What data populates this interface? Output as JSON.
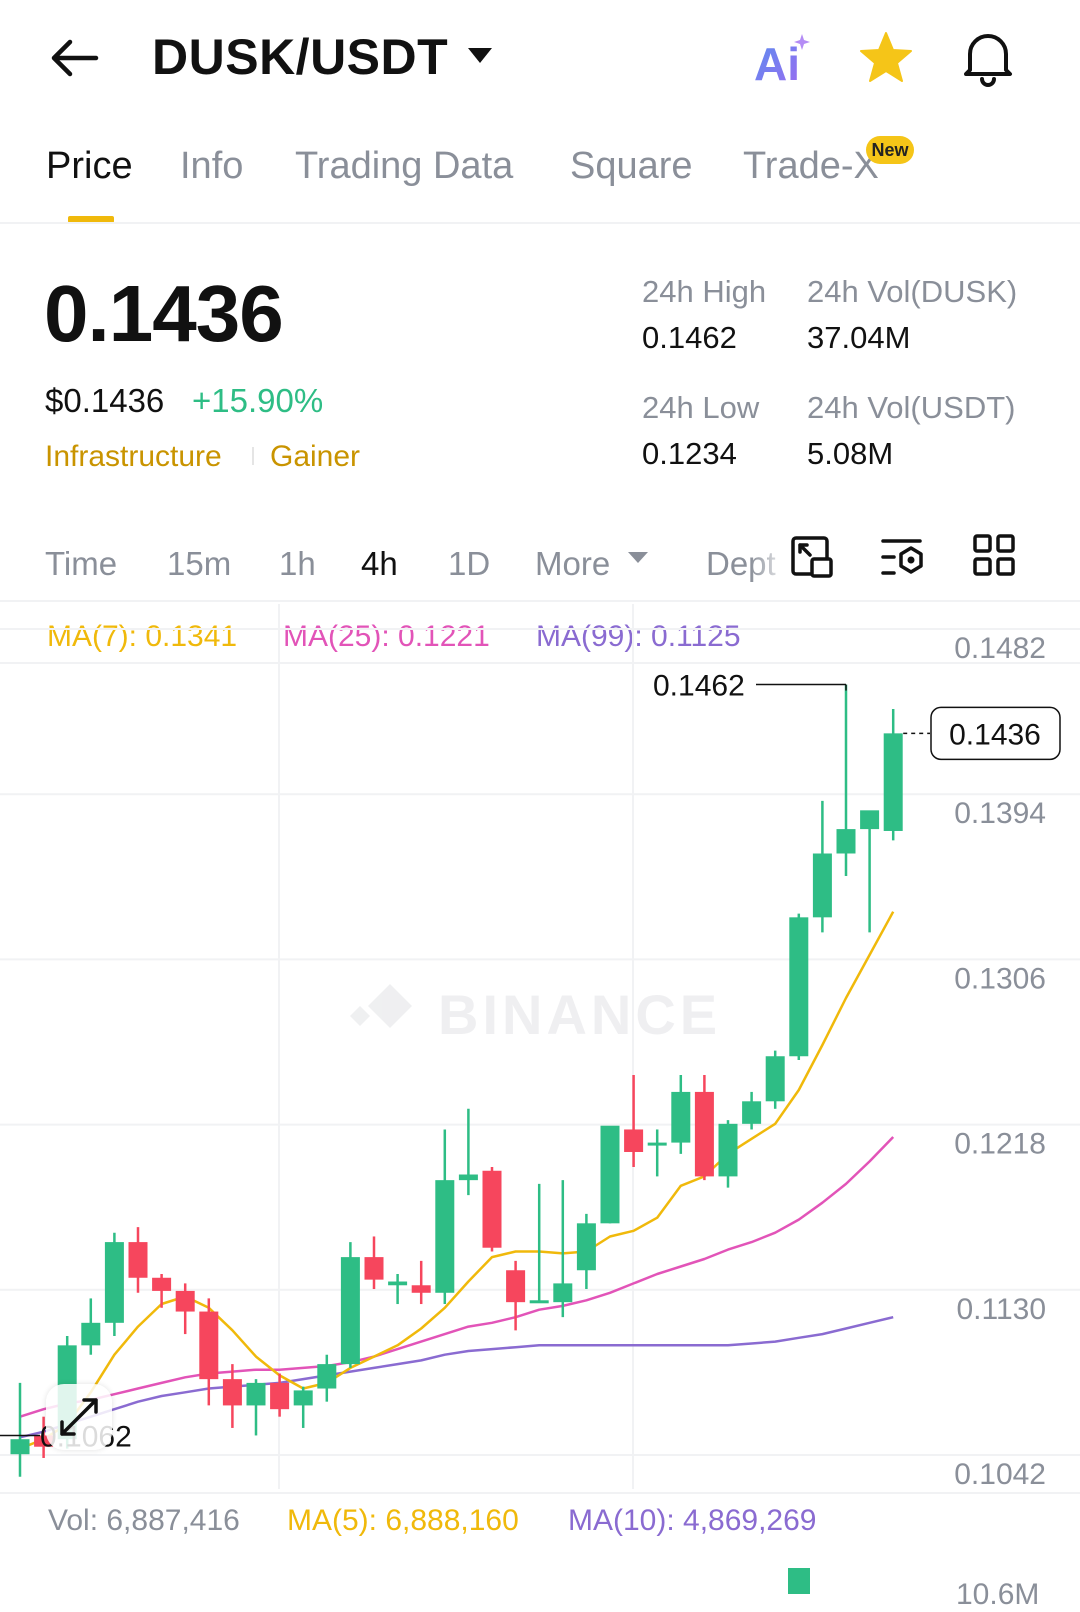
{
  "header": {
    "title": "DUSK/USDT",
    "ai_label": "Ai"
  },
  "tabs": [
    {
      "label": "Price",
      "active": true
    },
    {
      "label": "Info"
    },
    {
      "label": "Trading Data"
    },
    {
      "label": "Square"
    },
    {
      "label": "Trade-X",
      "badge": "New"
    }
  ],
  "price": {
    "last": "0.1436",
    "fiat": "$0.1436",
    "change": "+15.90%",
    "tags": [
      "Infrastructure",
      "Gainer"
    ]
  },
  "stats": {
    "high_label": "24h High",
    "high": "0.1462",
    "low_label": "24h Low",
    "low": "0.1234",
    "vol_base_label": "24h Vol(DUSK)",
    "vol_base": "37.04M",
    "vol_quote_label": "24h Vol(USDT)",
    "vol_quote": "5.08M"
  },
  "timeframes": {
    "items": [
      "Time",
      "15m",
      "1h",
      "4h",
      "1D",
      "More",
      "Dept"
    ],
    "active": "4h"
  },
  "ma": {
    "ma7": "MA(7): 0.1341",
    "ma25": "MA(25): 0.1221",
    "ma99": "MA(99): 0.1125"
  },
  "volume": {
    "vol": "Vol: 6,887,416",
    "ma5": "MA(5): 6,888,160",
    "ma10": "MA(10): 4,869,269",
    "axis_partial": "10.6M"
  },
  "colors": {
    "up": "#2ebd85",
    "down": "#f6465d",
    "ma7": "#f0b90b",
    "ma25": "#e254b8",
    "ma99": "#8a6bd1",
    "accent": "#f0b90b"
  },
  "chart_data": {
    "type": "candlestick",
    "watermark": "BINANCE",
    "y_ticks": [
      "0.1482",
      "0.1394",
      "0.1306",
      "0.1218",
      "0.1130",
      "0.1042"
    ],
    "ylim": [
      0.1042,
      0.1482
    ],
    "current_price": "0.1436",
    "high_marker": "0.1462",
    "low_marker": "0.1062",
    "candles": [
      {
        "o": 0.1052,
        "h": 0.109,
        "l": 0.104,
        "c": 0.106
      },
      {
        "o": 0.1062,
        "h": 0.1072,
        "l": 0.105,
        "c": 0.1056
      },
      {
        "o": 0.106,
        "h": 0.1115,
        "l": 0.1055,
        "c": 0.111
      },
      {
        "o": 0.111,
        "h": 0.1135,
        "l": 0.1105,
        "c": 0.1122
      },
      {
        "o": 0.1122,
        "h": 0.117,
        "l": 0.1115,
        "c": 0.1165
      },
      {
        "o": 0.1165,
        "h": 0.1173,
        "l": 0.1138,
        "c": 0.1146
      },
      {
        "o": 0.1146,
        "h": 0.1148,
        "l": 0.113,
        "c": 0.1139
      },
      {
        "o": 0.1139,
        "h": 0.1143,
        "l": 0.1116,
        "c": 0.1128
      },
      {
        "o": 0.1128,
        "h": 0.1135,
        "l": 0.1078,
        "c": 0.1092
      },
      {
        "o": 0.1092,
        "h": 0.11,
        "l": 0.1066,
        "c": 0.1078
      },
      {
        "o": 0.1078,
        "h": 0.1092,
        "l": 0.1062,
        "c": 0.109
      },
      {
        "o": 0.109,
        "h": 0.1095,
        "l": 0.1072,
        "c": 0.1076
      },
      {
        "o": 0.1078,
        "h": 0.1088,
        "l": 0.1066,
        "c": 0.1086
      },
      {
        "o": 0.1087,
        "h": 0.1105,
        "l": 0.108,
        "c": 0.11
      },
      {
        "o": 0.11,
        "h": 0.1165,
        "l": 0.1098,
        "c": 0.1157
      },
      {
        "o": 0.1157,
        "h": 0.1168,
        "l": 0.114,
        "c": 0.1145
      },
      {
        "o": 0.1142,
        "h": 0.1148,
        "l": 0.1132,
        "c": 0.1144
      },
      {
        "o": 0.1142,
        "h": 0.1155,
        "l": 0.1132,
        "c": 0.1138
      },
      {
        "o": 0.1138,
        "h": 0.1225,
        "l": 0.1132,
        "c": 0.1198
      },
      {
        "o": 0.1198,
        "h": 0.1236,
        "l": 0.119,
        "c": 0.1201
      },
      {
        "o": 0.1203,
        "h": 0.1205,
        "l": 0.116,
        "c": 0.1162
      },
      {
        "o": 0.115,
        "h": 0.1155,
        "l": 0.1118,
        "c": 0.1133
      },
      {
        "o": 0.1133,
        "h": 0.1196,
        "l": 0.1133,
        "c": 0.1134
      },
      {
        "o": 0.1133,
        "h": 0.1198,
        "l": 0.1125,
        "c": 0.1143
      },
      {
        "o": 0.115,
        "h": 0.118,
        "l": 0.114,
        "c": 0.1175
      },
      {
        "o": 0.1175,
        "h": 0.1222,
        "l": 0.1175,
        "c": 0.1227
      },
      {
        "o": 0.1225,
        "h": 0.1254,
        "l": 0.1205,
        "c": 0.1213
      },
      {
        "o": 0.1217,
        "h": 0.1225,
        "l": 0.12,
        "c": 0.1218
      },
      {
        "o": 0.1218,
        "h": 0.1254,
        "l": 0.1212,
        "c": 0.1245
      },
      {
        "o": 0.1245,
        "h": 0.1254,
        "l": 0.1198,
        "c": 0.12
      },
      {
        "o": 0.12,
        "h": 0.123,
        "l": 0.1194,
        "c": 0.1228
      },
      {
        "o": 0.1228,
        "h": 0.1245,
        "l": 0.1225,
        "c": 0.124
      },
      {
        "o": 0.124,
        "h": 0.1267,
        "l": 0.1236,
        "c": 0.1264
      },
      {
        "o": 0.1264,
        "h": 0.134,
        "l": 0.1262,
        "c": 0.1338
      },
      {
        "o": 0.1338,
        "h": 0.14,
        "l": 0.133,
        "c": 0.1372
      },
      {
        "o": 0.1372,
        "h": 0.1462,
        "l": 0.136,
        "c": 0.1385
      },
      {
        "o": 0.1385,
        "h": 0.1388,
        "l": 0.133,
        "c": 0.1395
      },
      {
        "o": 0.1384,
        "h": 0.1449,
        "l": 0.1379,
        "c": 0.1436
      }
    ],
    "ma7_line": [
      0.1055,
      0.106,
      0.1068,
      0.1085,
      0.1105,
      0.112,
      0.1132,
      0.1136,
      0.113,
      0.1118,
      0.1104,
      0.1094,
      0.1087,
      0.109,
      0.1098,
      0.1104,
      0.111,
      0.1119,
      0.113,
      0.1144,
      0.1157,
      0.116,
      0.116,
      0.1159,
      0.116,
      0.1168,
      0.1171,
      0.1178,
      0.1195,
      0.12,
      0.1212,
      0.122,
      0.1228,
      0.1246,
      0.127,
      0.1295,
      0.1318,
      0.1341
    ],
    "ma25_line": [
      0.1072,
      0.1076,
      0.1079,
      0.1081,
      0.1084,
      0.1087,
      0.109,
      0.1093,
      0.1095,
      0.1096,
      0.1097,
      0.1097,
      0.1098,
      0.1099,
      0.1101,
      0.1104,
      0.1108,
      0.1112,
      0.1116,
      0.112,
      0.1122,
      0.1125,
      0.1129,
      0.1131,
      0.1134,
      0.1138,
      0.1143,
      0.1148,
      0.1152,
      0.1156,
      0.1161,
      0.1165,
      0.117,
      0.1177,
      0.1186,
      0.1196,
      0.1208,
      0.1221
    ],
    "ma99_line": [
      0.1061,
      0.1064,
      0.1068,
      0.1072,
      0.1076,
      0.108,
      0.1083,
      0.1085,
      0.1087,
      0.1088,
      0.1089,
      0.109,
      0.1092,
      0.1094,
      0.1096,
      0.1098,
      0.11,
      0.1102,
      0.1105,
      0.1107,
      0.1108,
      0.1109,
      0.111,
      0.111,
      0.111,
      0.111,
      0.111,
      0.111,
      0.111,
      0.111,
      0.111,
      0.1111,
      0.1112,
      0.1114,
      0.1116,
      0.1119,
      0.1122,
      0.1125
    ]
  }
}
